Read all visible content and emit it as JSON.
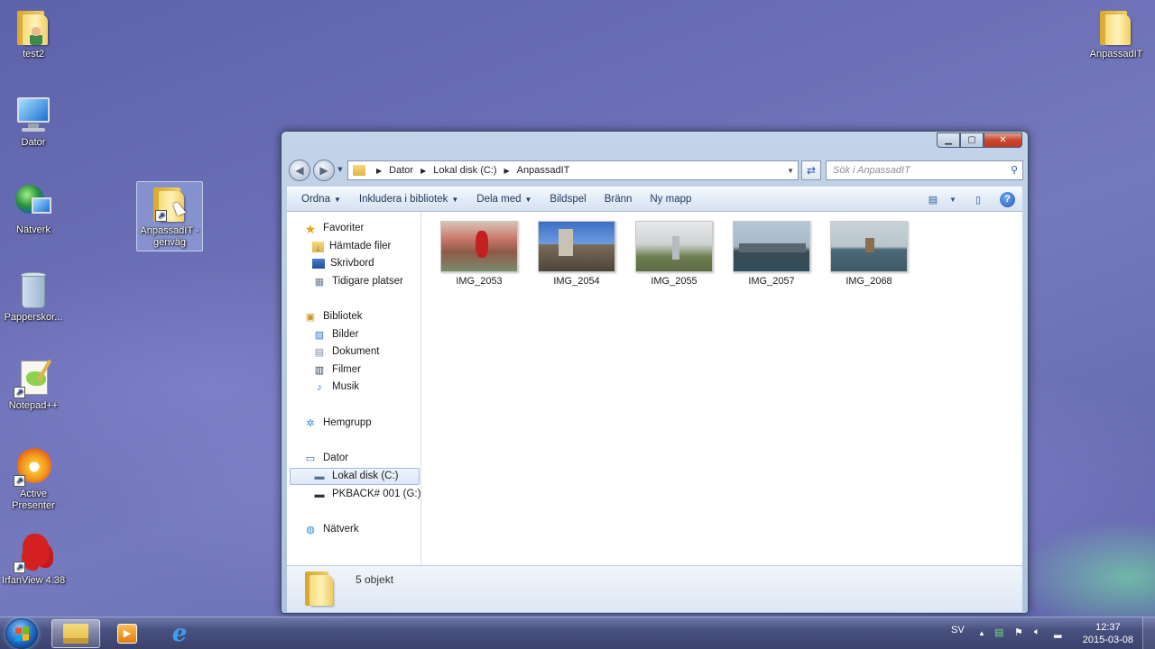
{
  "desktop": {
    "icons": [
      {
        "label": "test2",
        "icon": "user-folder-icon"
      },
      {
        "label": "Dator",
        "icon": "computer-icon"
      },
      {
        "label": "Nätverk",
        "icon": "network-globe-icon"
      },
      {
        "label": "Papperskor...",
        "icon": "recycle-bin-icon"
      },
      {
        "label": "Notepad++",
        "icon": "notepad-plus-plus-icon"
      },
      {
        "label": "Active Presenter",
        "icon": "active-presenter-icon"
      },
      {
        "label": "IrfanView 4.38",
        "icon": "irfanview-icon"
      },
      {
        "label": "AnpassadIT - genväg",
        "icon": "folder-shortcut-icon"
      },
      {
        "label": "AnpassadIT",
        "icon": "folder-icon"
      }
    ]
  },
  "explorer": {
    "breadcrumb": [
      "Dator",
      "Lokal disk (C:)",
      "AnpassadIT"
    ],
    "search_placeholder": "Sök i AnpassadIT",
    "toolbar": {
      "ordna": "Ordna",
      "inkludera": "Inkludera i bibliotek",
      "dela": "Dela med",
      "bildspel": "Bildspel",
      "branna": "Bränn",
      "ny_mapp": "Ny mapp"
    },
    "nav": {
      "favoriter": "Favoriter",
      "hamtade": "Hämtade filer",
      "skrivbord": "Skrivbord",
      "tidigare": "Tidigare platser",
      "bibliotek": "Bibliotek",
      "bilder": "Bilder",
      "dokument": "Dokument",
      "filmer": "Filmer",
      "musik": "Musik",
      "hemgrupp": "Hemgrupp",
      "dator": "Dator",
      "lokal_disk": "Lokal disk (C:)",
      "pkback": "PKBACK# 001 (G:)",
      "natverk": "Nätverk"
    },
    "files": [
      {
        "name": "IMG_2053"
      },
      {
        "name": "IMG_2054"
      },
      {
        "name": "IMG_2055"
      },
      {
        "name": "IMG_2057"
      },
      {
        "name": "IMG_2068"
      }
    ],
    "status": "5 objekt"
  },
  "taskbar": {
    "language": "SV",
    "time": "12:37",
    "date": "2015-03-08"
  }
}
